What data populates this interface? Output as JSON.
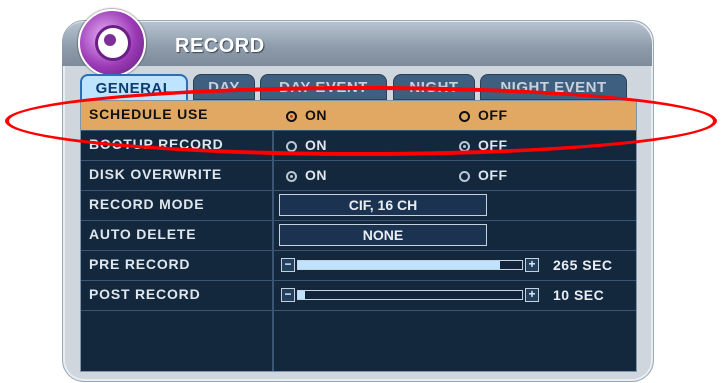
{
  "window": {
    "title": "RECORD"
  },
  "tabs": [
    {
      "label": "GENERAL",
      "active": true
    },
    {
      "label": "DAY",
      "active": false
    },
    {
      "label": "DAY EVENT",
      "active": false
    },
    {
      "label": "NIGHT",
      "active": false
    },
    {
      "label": "NIGHT EVENT",
      "active": false
    }
  ],
  "rows": {
    "schedule_use": {
      "label": "SCHEDULE USE",
      "on": "ON",
      "off": "OFF",
      "selected": "ON"
    },
    "bootup_record": {
      "label": "BOOTUP RECORD",
      "on": "ON",
      "off": "OFF",
      "selected": "OFF"
    },
    "disk_overwrite": {
      "label": "DISK OVERWRITE",
      "on": "ON",
      "off": "OFF",
      "selected": "ON"
    },
    "record_mode": {
      "label": "RECORD MODE",
      "value": "CIF, 16 CH"
    },
    "auto_delete": {
      "label": "AUTO DELETE",
      "value": "NONE"
    },
    "pre_record": {
      "label": "PRE RECORD",
      "value_text": "265 SEC",
      "level": 0.9
    },
    "post_record": {
      "label": "POST RECORD",
      "value_text": "10 SEC",
      "level": 0.03
    }
  },
  "colors": {
    "highlight": "#e0a862",
    "panel": "#13273d",
    "annotation": "#ff0000"
  },
  "icons": {
    "slider_decrease": "−",
    "slider_increase": "+"
  }
}
